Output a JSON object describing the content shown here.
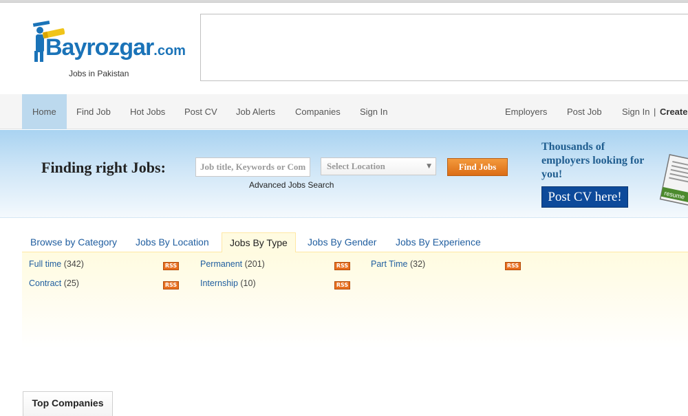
{
  "brand": {
    "name": "Bayrozgar",
    "domain_suffix": ".com",
    "tagline": "Jobs in Pakistan",
    "color": "#1a73b8"
  },
  "nav": {
    "left": [
      "Home",
      "Find Job",
      "Hot Jobs",
      "Post CV",
      "Job Alerts",
      "Companies",
      "Sign In"
    ],
    "right": {
      "employers": "Employers",
      "post_job": "Post Job",
      "sign_in": "Sign In",
      "separator": "|",
      "create": "Create"
    },
    "active_color": "#bcd9ee"
  },
  "search": {
    "title": "Finding right Jobs:",
    "keyword_placeholder": "Job title, Keywords or Company",
    "location_value": "Select Location",
    "find_button": "Find Jobs",
    "advanced_link": "Advanced Jobs Search",
    "button_color": "#e8801f"
  },
  "promo": {
    "text": "Thousands of employers looking for you!",
    "button": "Post CV here!",
    "resume_label": "resume",
    "button_color": "#0d4a9a"
  },
  "tabs": {
    "items": [
      "Browse by Category",
      "Jobs By Location",
      "Jobs By Type",
      "Jobs By Gender",
      "Jobs By Experience"
    ],
    "active": "Jobs By Type"
  },
  "job_types": [
    {
      "label": "Full time",
      "count": "(342)"
    },
    {
      "label": "Permanent",
      "count": "(201)"
    },
    {
      "label": "Part Time",
      "count": "(32)"
    },
    {
      "label": "Contract",
      "count": "(25)"
    },
    {
      "label": "Internship",
      "count": "(10)"
    }
  ],
  "rss_label": "RSS",
  "sections": {
    "top_companies": "Top Companies"
  }
}
